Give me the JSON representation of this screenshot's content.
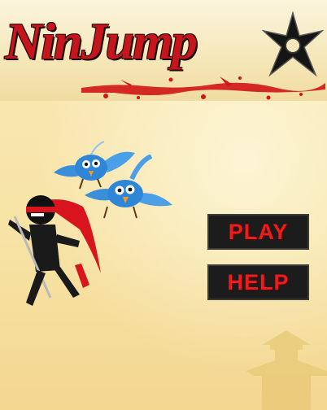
{
  "title": {
    "logo_text": "NinJump"
  },
  "menu": {
    "play_label": "PLAY",
    "help_label": "HELP"
  },
  "colors": {
    "menu_text": "#ee1c1c",
    "menu_background": "#1c1c1c",
    "sky": "#f7e3a5",
    "logo_red": "#c4161c"
  },
  "icons": {
    "logo_emblem": "shuriken-icon"
  }
}
